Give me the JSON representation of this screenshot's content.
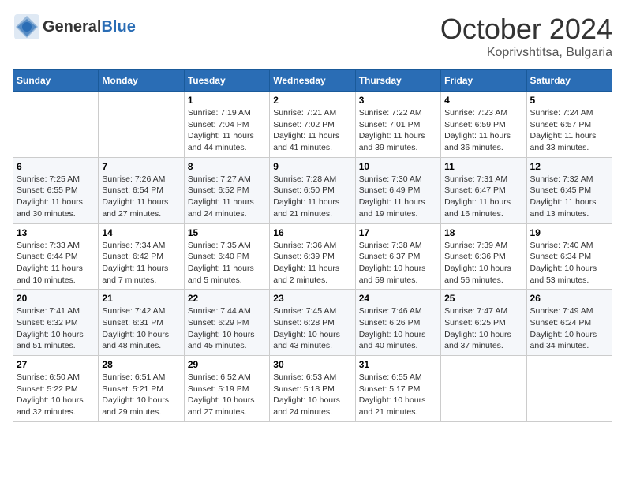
{
  "header": {
    "logo_general": "General",
    "logo_blue": "Blue",
    "month_title": "October 2024",
    "location": "Koprivshtitsa, Bulgaria"
  },
  "weekdays": [
    "Sunday",
    "Monday",
    "Tuesday",
    "Wednesday",
    "Thursday",
    "Friday",
    "Saturday"
  ],
  "weeks": [
    [
      {
        "day": "",
        "detail": ""
      },
      {
        "day": "",
        "detail": ""
      },
      {
        "day": "1",
        "detail": "Sunrise: 7:19 AM\nSunset: 7:04 PM\nDaylight: 11 hours and 44 minutes."
      },
      {
        "day": "2",
        "detail": "Sunrise: 7:21 AM\nSunset: 7:02 PM\nDaylight: 11 hours and 41 minutes."
      },
      {
        "day": "3",
        "detail": "Sunrise: 7:22 AM\nSunset: 7:01 PM\nDaylight: 11 hours and 39 minutes."
      },
      {
        "day": "4",
        "detail": "Sunrise: 7:23 AM\nSunset: 6:59 PM\nDaylight: 11 hours and 36 minutes."
      },
      {
        "day": "5",
        "detail": "Sunrise: 7:24 AM\nSunset: 6:57 PM\nDaylight: 11 hours and 33 minutes."
      }
    ],
    [
      {
        "day": "6",
        "detail": "Sunrise: 7:25 AM\nSunset: 6:55 PM\nDaylight: 11 hours and 30 minutes."
      },
      {
        "day": "7",
        "detail": "Sunrise: 7:26 AM\nSunset: 6:54 PM\nDaylight: 11 hours and 27 minutes."
      },
      {
        "day": "8",
        "detail": "Sunrise: 7:27 AM\nSunset: 6:52 PM\nDaylight: 11 hours and 24 minutes."
      },
      {
        "day": "9",
        "detail": "Sunrise: 7:28 AM\nSunset: 6:50 PM\nDaylight: 11 hours and 21 minutes."
      },
      {
        "day": "10",
        "detail": "Sunrise: 7:30 AM\nSunset: 6:49 PM\nDaylight: 11 hours and 19 minutes."
      },
      {
        "day": "11",
        "detail": "Sunrise: 7:31 AM\nSunset: 6:47 PM\nDaylight: 11 hours and 16 minutes."
      },
      {
        "day": "12",
        "detail": "Sunrise: 7:32 AM\nSunset: 6:45 PM\nDaylight: 11 hours and 13 minutes."
      }
    ],
    [
      {
        "day": "13",
        "detail": "Sunrise: 7:33 AM\nSunset: 6:44 PM\nDaylight: 11 hours and 10 minutes."
      },
      {
        "day": "14",
        "detail": "Sunrise: 7:34 AM\nSunset: 6:42 PM\nDaylight: 11 hours and 7 minutes."
      },
      {
        "day": "15",
        "detail": "Sunrise: 7:35 AM\nSunset: 6:40 PM\nDaylight: 11 hours and 5 minutes."
      },
      {
        "day": "16",
        "detail": "Sunrise: 7:36 AM\nSunset: 6:39 PM\nDaylight: 11 hours and 2 minutes."
      },
      {
        "day": "17",
        "detail": "Sunrise: 7:38 AM\nSunset: 6:37 PM\nDaylight: 10 hours and 59 minutes."
      },
      {
        "day": "18",
        "detail": "Sunrise: 7:39 AM\nSunset: 6:36 PM\nDaylight: 10 hours and 56 minutes."
      },
      {
        "day": "19",
        "detail": "Sunrise: 7:40 AM\nSunset: 6:34 PM\nDaylight: 10 hours and 53 minutes."
      }
    ],
    [
      {
        "day": "20",
        "detail": "Sunrise: 7:41 AM\nSunset: 6:32 PM\nDaylight: 10 hours and 51 minutes."
      },
      {
        "day": "21",
        "detail": "Sunrise: 7:42 AM\nSunset: 6:31 PM\nDaylight: 10 hours and 48 minutes."
      },
      {
        "day": "22",
        "detail": "Sunrise: 7:44 AM\nSunset: 6:29 PM\nDaylight: 10 hours and 45 minutes."
      },
      {
        "day": "23",
        "detail": "Sunrise: 7:45 AM\nSunset: 6:28 PM\nDaylight: 10 hours and 43 minutes."
      },
      {
        "day": "24",
        "detail": "Sunrise: 7:46 AM\nSunset: 6:26 PM\nDaylight: 10 hours and 40 minutes."
      },
      {
        "day": "25",
        "detail": "Sunrise: 7:47 AM\nSunset: 6:25 PM\nDaylight: 10 hours and 37 minutes."
      },
      {
        "day": "26",
        "detail": "Sunrise: 7:49 AM\nSunset: 6:24 PM\nDaylight: 10 hours and 34 minutes."
      }
    ],
    [
      {
        "day": "27",
        "detail": "Sunrise: 6:50 AM\nSunset: 5:22 PM\nDaylight: 10 hours and 32 minutes."
      },
      {
        "day": "28",
        "detail": "Sunrise: 6:51 AM\nSunset: 5:21 PM\nDaylight: 10 hours and 29 minutes."
      },
      {
        "day": "29",
        "detail": "Sunrise: 6:52 AM\nSunset: 5:19 PM\nDaylight: 10 hours and 27 minutes."
      },
      {
        "day": "30",
        "detail": "Sunrise: 6:53 AM\nSunset: 5:18 PM\nDaylight: 10 hours and 24 minutes."
      },
      {
        "day": "31",
        "detail": "Sunrise: 6:55 AM\nSunset: 5:17 PM\nDaylight: 10 hours and 21 minutes."
      },
      {
        "day": "",
        "detail": ""
      },
      {
        "day": "",
        "detail": ""
      }
    ]
  ]
}
